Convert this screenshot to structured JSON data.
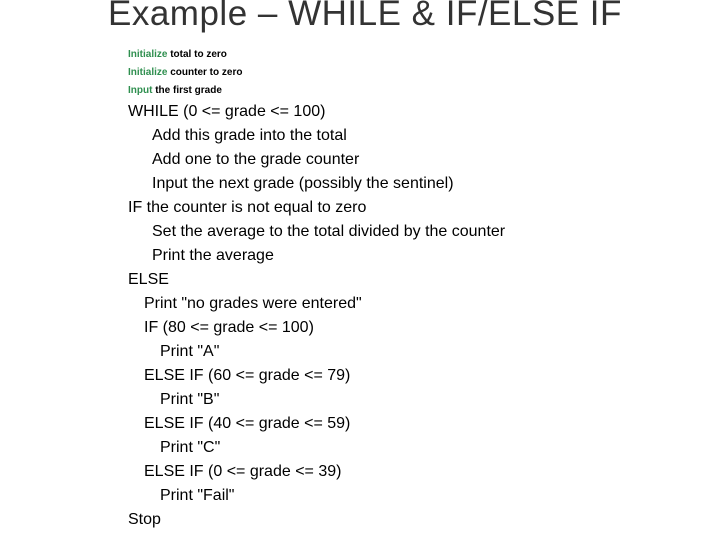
{
  "title": "Example – WHILE & IF/ELSE IF",
  "small": [
    {
      "kw": "Initialize",
      "rest": " total to zero"
    },
    {
      "kw": "Initialize",
      "rest": " counter to zero"
    },
    {
      "kw": "Input",
      "rest": " the first grade"
    }
  ],
  "lines": [
    {
      "indent": "i1",
      "text": "WHILE (0 <= grade <= 100)"
    },
    {
      "indent": "i2",
      "text": "Add this grade into the total"
    },
    {
      "indent": "i2",
      "text": "Add one to the grade counter"
    },
    {
      "indent": "i2",
      "text": "Input the next grade (possibly the sentinel)"
    },
    {
      "indent": "i1",
      "text": "IF the counter is not equal to zero"
    },
    {
      "indent": "i2",
      "text": "Set the average to the total divided by the counter"
    },
    {
      "indent": "i2",
      "text": "Print the average"
    },
    {
      "indent": "i1",
      "text": "ELSE"
    },
    {
      "indent": "i3",
      "text": "Print \"no grades were entered\""
    },
    {
      "indent": "i3",
      "text": "IF (80 <= grade <= 100)"
    },
    {
      "indent": "i4",
      "text": "Print  \"A\""
    },
    {
      "indent": "i3",
      "text": "ELSE IF (60 <= grade <= 79)"
    },
    {
      "indent": "i4",
      "text": "Print  \"B\""
    },
    {
      "indent": "i3",
      "text": "ELSE IF (40 <= grade <= 59)"
    },
    {
      "indent": "i4",
      "text": "Print  \"C\""
    },
    {
      "indent": "i3",
      "text": "ELSE IF (0 <= grade <= 39)"
    },
    {
      "indent": "i4",
      "text": "Print  \"Fail\""
    },
    {
      "indent": "i1",
      "text": "Stop"
    }
  ]
}
